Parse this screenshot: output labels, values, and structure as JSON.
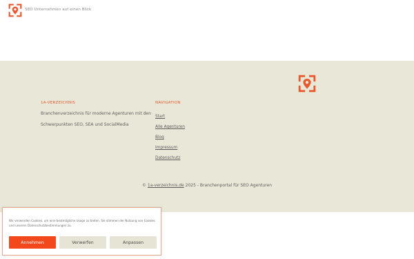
{
  "header": {
    "tagline": "SEO Unternehmen auf einen Blick",
    "logo_icon": "location-pin-frame-icon"
  },
  "footer": {
    "about": {
      "heading": "1A-VERZEICHNIS",
      "description_line1": "Branchenverzeichnis für moderne Agenturen mit den",
      "description_line2": "Schwerpunkten SEO, SEA und SocialMedia"
    },
    "navigation": {
      "heading": "NAVIGATION",
      "items": [
        {
          "label": "Start"
        },
        {
          "label": "Alle Agenturen"
        },
        {
          "label": "Blog"
        },
        {
          "label": "Impressum"
        },
        {
          "label": "Datenschutz"
        }
      ]
    },
    "copyright": {
      "prefix": "© ",
      "link_text": "1a-verzeichnis.de",
      "suffix": " 2025  -  Branchenportal für SEO Agenturen"
    }
  },
  "cookie_banner": {
    "text_line1": "Wir verwenden Cookies, um eine bestmögliche Usage zu bieten. Sie stimmen der Nutzung von Cookies",
    "text_line2": "und unseren Datenschutzbestimmungen zu.",
    "accept_label": "Annehmen",
    "reject_label": "Verwerfen",
    "customize_label": "Anpassen"
  },
  "colors": {
    "accent": "#f2481b",
    "footer_background": "#e9e8d8",
    "secondary_button": "#e6e5d5"
  }
}
